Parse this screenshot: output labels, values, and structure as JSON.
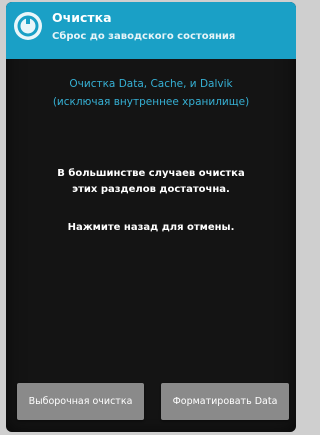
{
  "header": {
    "title": "Очистка",
    "subtitle": "Сброс до заводского состояния"
  },
  "info": {
    "line1": "Очистка Data, Cache, и Dalvik",
    "line2": "(исключая внутреннее хранилище)"
  },
  "message": {
    "line1": "В большинстве случаев очистка",
    "line2": "этих разделов достаточна.",
    "line3": "Нажмите назад для отмены."
  },
  "buttons": {
    "advanced_wipe": "Выборочная очистка",
    "format_data": "Форматировать Data"
  },
  "colors": {
    "header": "#1aa0c6",
    "info_text": "#36b0d4",
    "background": "#141414",
    "button": "#8a8a8a"
  }
}
